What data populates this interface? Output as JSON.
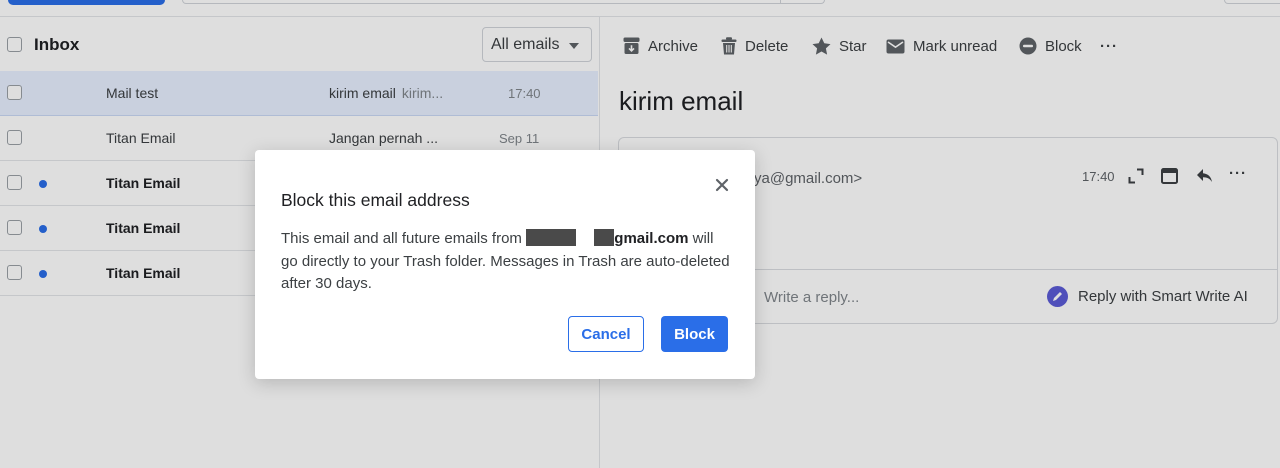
{
  "list": {
    "folder_title": "Inbox",
    "filter_label": "All emails",
    "rows": [
      {
        "sender": "Mail test",
        "subject": "kirim email",
        "snippet": "kirim...",
        "time": "17:40",
        "unread": false,
        "selected": true
      },
      {
        "sender": "Titan Email",
        "subject": "Jangan pernah ...",
        "snippet": "",
        "time": "Sep 11",
        "unread": false,
        "selected": false
      },
      {
        "sender": "Titan Email",
        "subject": "",
        "snippet": "",
        "time": "",
        "unread": true,
        "selected": false
      },
      {
        "sender": "Titan Email",
        "subject": "",
        "snippet": "",
        "time": "",
        "unread": true,
        "selected": false
      },
      {
        "sender": "Titan Email",
        "subject": "",
        "snippet": "",
        "time": "",
        "unread": true,
        "selected": false
      }
    ]
  },
  "toolbar": {
    "archive": "Archive",
    "delete": "Delete",
    "star": "Star",
    "mark_unread": "Mark unread",
    "block": "Block",
    "more": "···"
  },
  "message": {
    "title": "kirim email",
    "from_partial": "ya@gmail.com>",
    "time": "17:40",
    "reply_placeholder": "Write a reply...",
    "smart_reply": "Reply with Smart Write AI"
  },
  "dialog": {
    "title": "Block this email address",
    "body_prefix": "This email and all future emails from",
    "email_domain": "gmail.com",
    "body_suffix": "will go directly to your Trash folder. Messages in Trash are auto-deleted after 30 days.",
    "cancel_label": "Cancel",
    "block_label": "Block"
  },
  "colors": {
    "accent": "#2a6ee8",
    "selected_row": "#e7efff",
    "unread_dot": "#2a6ee8",
    "smart_write_icon": "#5b5bd6"
  }
}
